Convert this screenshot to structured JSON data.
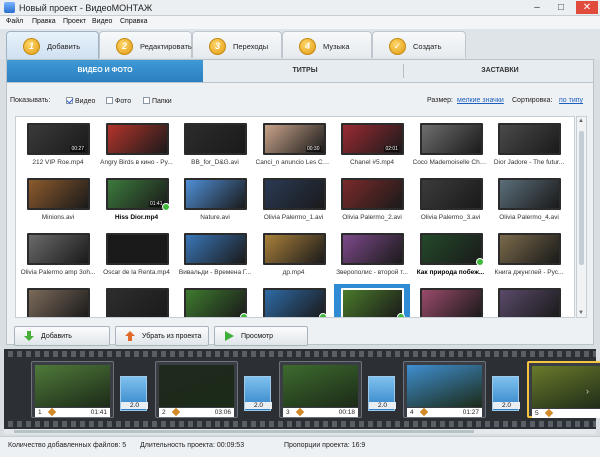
{
  "window": {
    "title": "Новый проект - ВидеоМОНТАЖ",
    "minimize": "–",
    "maximize": "□",
    "close": "✕"
  },
  "menu": [
    "Файл",
    "Правка",
    "Проект",
    "Видео",
    "Справка"
  ],
  "steps": [
    {
      "num": "1",
      "label": "Добавить",
      "active": true
    },
    {
      "num": "2",
      "label": "Редактировать",
      "active": false
    },
    {
      "num": "3",
      "label": "Переходы",
      "active": false
    },
    {
      "num": "4",
      "label": "Музыка",
      "active": false
    },
    {
      "num": "",
      "label": "Создать",
      "active": false
    }
  ],
  "subtabs": [
    "ВИДЕО И ФОТО",
    "ТИТРЫ",
    "ЗАСТАВКИ"
  ],
  "filter": {
    "show_label": "Показывать:",
    "video": "Видео",
    "photo": "Фото",
    "folders": "Папки",
    "size_label": "Размер:",
    "size_value": "мелкие значки",
    "sort_label": "Сортировка:",
    "sort_value": "по типу"
  },
  "files": [
    {
      "name": "212 VIP Roe.mp4",
      "dur": "00:27",
      "checked": false,
      "bold": false,
      "color": "#3a3a3a"
    },
    {
      "name": "Angry Birds в кино - Py...",
      "dur": "",
      "checked": false,
      "bold": false,
      "color": "#b3342b"
    },
    {
      "name": "BB_for_D&G.avi",
      "dur": "",
      "checked": false,
      "bold": false,
      "color": "#2c2c2c"
    },
    {
      "name": "Canci_n anuncio Les Ca...",
      "dur": "00:30",
      "checked": false,
      "bold": false,
      "color": "#c9a38a"
    },
    {
      "name": "Chanel #5.mp4",
      "dur": "02:01",
      "checked": false,
      "bold": false,
      "color": "#9a2a33"
    },
    {
      "name": "Coco Mademoiselle Cha...",
      "dur": "",
      "checked": false,
      "bold": false,
      "color": "#6e6e6e"
    },
    {
      "name": "Dior Jadore - The futur...",
      "dur": "",
      "checked": false,
      "bold": false,
      "color": "#4a4a4a"
    },
    {
      "name": "Minions.avi",
      "dur": "",
      "checked": false,
      "bold": false,
      "color": "#8c5a2c"
    },
    {
      "name": "Hiss Dior.mp4",
      "dur": "01:41",
      "checked": true,
      "bold": true,
      "color": "#3c7a3c"
    },
    {
      "name": "Nature.avi",
      "dur": "",
      "checked": false,
      "bold": false,
      "color": "#4f8fd6"
    },
    {
      "name": "Olivia Palermo_1.avi",
      "dur": "",
      "checked": false,
      "bold": false,
      "color": "#2a3a55"
    },
    {
      "name": "Olivia Palermo_2.avi",
      "dur": "",
      "checked": false,
      "bold": false,
      "color": "#7a2a2a"
    },
    {
      "name": "Olivia Palermo_3.avi",
      "dur": "",
      "checked": false,
      "bold": false,
      "color": "#3b3b3b"
    },
    {
      "name": "Olivia Palermo_4.avi",
      "dur": "",
      "checked": false,
      "bold": false,
      "color": "#5a6e7a"
    },
    {
      "name": "Olivia Palermo amp 3oh...",
      "dur": "",
      "checked": false,
      "bold": false,
      "color": "#6a6a6a"
    },
    {
      "name": "Oscar de la Renta.mp4",
      "dur": "",
      "checked": false,
      "bold": false,
      "color": "#1a1a1a"
    },
    {
      "name": "Вивальди - Временa Г...",
      "dur": "",
      "checked": false,
      "bold": false,
      "color": "#3a76b8"
    },
    {
      "name": "др.mp4",
      "dur": "",
      "checked": false,
      "bold": false,
      "color": "#a9803a"
    },
    {
      "name": "Зверополис - второй т...",
      "dur": "",
      "checked": false,
      "bold": false,
      "color": "#7d4a8a"
    },
    {
      "name": "Как природа побеж...",
      "dur": "",
      "checked": true,
      "bold": true,
      "color": "#234a2a"
    },
    {
      "name": "Книга джунглей - Рус...",
      "dur": "",
      "checked": false,
      "bold": false,
      "color": "#7a6a4a"
    },
    {
      "name": "",
      "dur": "",
      "checked": false,
      "bold": false,
      "color": "#7c6a5a"
    },
    {
      "name": "",
      "dur": "",
      "checked": false,
      "bold": false,
      "color": "#2e2e2e"
    },
    {
      "name": "",
      "dur": "",
      "checked": true,
      "bold": false,
      "color": "#3e7a2e"
    },
    {
      "name": "",
      "dur": "",
      "checked": true,
      "bold": false,
      "color": "#2e6aa6"
    },
    {
      "name": "",
      "dur": "",
      "checked": true,
      "bold": false,
      "color": "#4a7a2a",
      "selected": true
    },
    {
      "name": "",
      "dur": "",
      "checked": false,
      "bold": false,
      "color": "#9a4a6a"
    },
    {
      "name": "",
      "dur": "",
      "checked": false,
      "bold": false,
      "color": "#5a4a6a"
    }
  ],
  "actions": {
    "add": "Добавить",
    "remove": "Убрать из проекта",
    "preview": "Просмотр"
  },
  "timeline": {
    "clips": [
      {
        "idx": "1",
        "dur": "01:41",
        "color": "#4f7a3a"
      },
      {
        "idx": "2",
        "dur": "03:06",
        "color": "#1e2a1e"
      },
      {
        "idx": "3",
        "dur": "00:18",
        "color": "#3d6b2e"
      },
      {
        "idx": "4",
        "dur": "01:27",
        "color": "#3f8fd0"
      },
      {
        "idx": "5",
        "dur": "",
        "color": "#6a7a2a"
      }
    ],
    "transitions": [
      "2.0",
      "2.0",
      "2.0",
      "2.0"
    ],
    "next": "›"
  },
  "status": {
    "files_added": "Количество добавленных файлов: 5",
    "duration": "Длительность проекта: 00:09:53",
    "ratio": "Пропорции проекта: 16:9"
  }
}
